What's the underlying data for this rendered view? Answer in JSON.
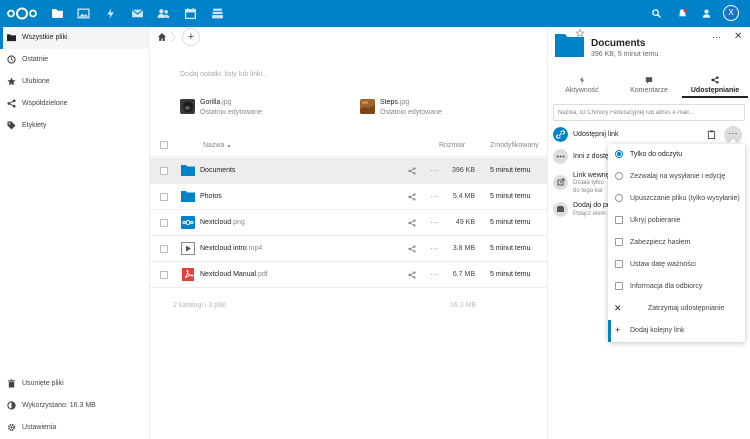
{
  "colors": {
    "brand": "#0082c9",
    "selected_row": "#ededed"
  },
  "header": {
    "logo": "nextcloud-logo",
    "apps": [
      "files-icon",
      "photos-icon",
      "activity-icon",
      "mail-icon",
      "contacts-icon",
      "calendar-icon",
      "deck-icon"
    ],
    "right_icons": [
      "search-icon",
      "notifications-icon",
      "contacts-menu-icon"
    ],
    "avatar_letter": "X"
  },
  "sidebar": {
    "items": [
      {
        "label": "Wszystkie pliki",
        "icon": "folder-icon"
      },
      {
        "label": "Ostatnie",
        "icon": "clock-icon"
      },
      {
        "label": "Ulubione",
        "icon": "star-icon"
      },
      {
        "label": "Współdzielone",
        "icon": "share-icon"
      },
      {
        "label": "Etykiety",
        "icon": "tag-icon"
      }
    ],
    "bottom": [
      {
        "label": "Usunięte pliki",
        "icon": "trash-icon"
      },
      {
        "label": "Wykorzystano: 16.3 MB",
        "icon": "quota-icon"
      },
      {
        "label": "Ustawienia",
        "icon": "gear-icon"
      }
    ]
  },
  "main": {
    "add_button": "+",
    "notes_placeholder": "Dodaj notatki, listy lub linki...",
    "recent": [
      {
        "name": "Gorilla",
        "ext": ".jpg",
        "sub": "Ostatnio edytowane"
      },
      {
        "name": "Steps",
        "ext": ".jpg",
        "sub": "Ostatnio edytowane"
      }
    ],
    "columns": {
      "name": "Nazwa",
      "sort_indicator": "▲",
      "size": "Rozmiar",
      "modified": "Zmodyfikowany"
    },
    "files": [
      {
        "name": "Documents",
        "ext": "",
        "size": "396 KB",
        "modified": "5 minut temu",
        "type": "folder"
      },
      {
        "name": "Photos",
        "ext": "",
        "size": "5.4 MB",
        "modified": "5 minut temu",
        "type": "folder"
      },
      {
        "name": "Nextcloud",
        "ext": ".png",
        "size": "49 KB",
        "modified": "5 minut temu",
        "type": "image"
      },
      {
        "name": "Nextcloud intro",
        "ext": ".mp4",
        "size": "3.8 MB",
        "modified": "5 minut temu",
        "type": "video"
      },
      {
        "name": "Nextcloud Manual",
        "ext": ".pdf",
        "size": "6.7 MB",
        "modified": "5 minut temu",
        "type": "pdf"
      }
    ],
    "summary": "2 katalogi i 3 pliki",
    "summary_size": "16.3 MB"
  },
  "panel": {
    "title": "Documents",
    "subtitle": "396 KB, 5 minut temu",
    "tabs": [
      {
        "label": "Aktywność",
        "icon": "activity-icon"
      },
      {
        "label": "Komentarze",
        "icon": "comment-icon"
      },
      {
        "label": "Udostępnianie",
        "icon": "share-icon"
      }
    ],
    "search_placeholder": "Nazwa, ID Chmury Federacyjnej lub adres e-mail...",
    "share_link_label": "Udostępnij link",
    "others_label": "Inni z dostę",
    "internal_link_label": "Link wewnę",
    "internal_link_sub1": "Działa tylko",
    "internal_link_sub2": "do tego kat",
    "add_label": "Dodaj do pr",
    "add_sub": "Połącz elem",
    "menu": {
      "radios": [
        {
          "label": "Tylko do odczytu",
          "checked": true
        },
        {
          "label": "Zezwalaj na wysyłanie i edycję",
          "checked": false
        },
        {
          "label": "Upuszczanie pliku (tylko wysyłanie)",
          "checked": false
        }
      ],
      "checkboxes": [
        {
          "label": "Ukryj pobieranie"
        },
        {
          "label": "Zabezpiecz hasłem"
        },
        {
          "label": "Ustaw datę ważności"
        },
        {
          "label": "Informacja dla odbiorcy"
        }
      ],
      "stop_label": "Zatrzymaj udostępnianie",
      "add_another_label": "Dodaj kolejny link"
    }
  }
}
